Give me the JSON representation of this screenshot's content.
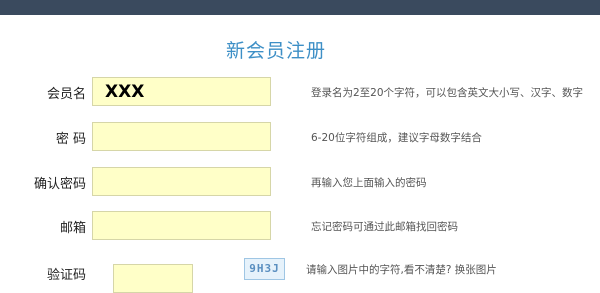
{
  "title": "新会员注册",
  "fields": [
    {
      "label": "会员名",
      "value": "XXX",
      "hint": "登录名为2至20个字符，可以包含英文大小写、汉字、数字"
    },
    {
      "label": "密 码",
      "value": "",
      "hint": "6-20位字符组成，建议字母数字结合"
    },
    {
      "label": "确认密码",
      "value": "",
      "hint": "再输入您上面输入的密码"
    },
    {
      "label": "邮箱",
      "value": "",
      "hint": "忘记密码可通过此邮箱找回密码"
    }
  ],
  "captcha": {
    "label": "验证码",
    "value": "",
    "code": "9H3J",
    "hint": "请输入图片中的字符,看不清楚?",
    "refresh_label": "换张图片"
  },
  "colors": {
    "title": "#3d8fc6",
    "field_background": "#ffffc8",
    "top_bar": "#3a4a5e"
  }
}
